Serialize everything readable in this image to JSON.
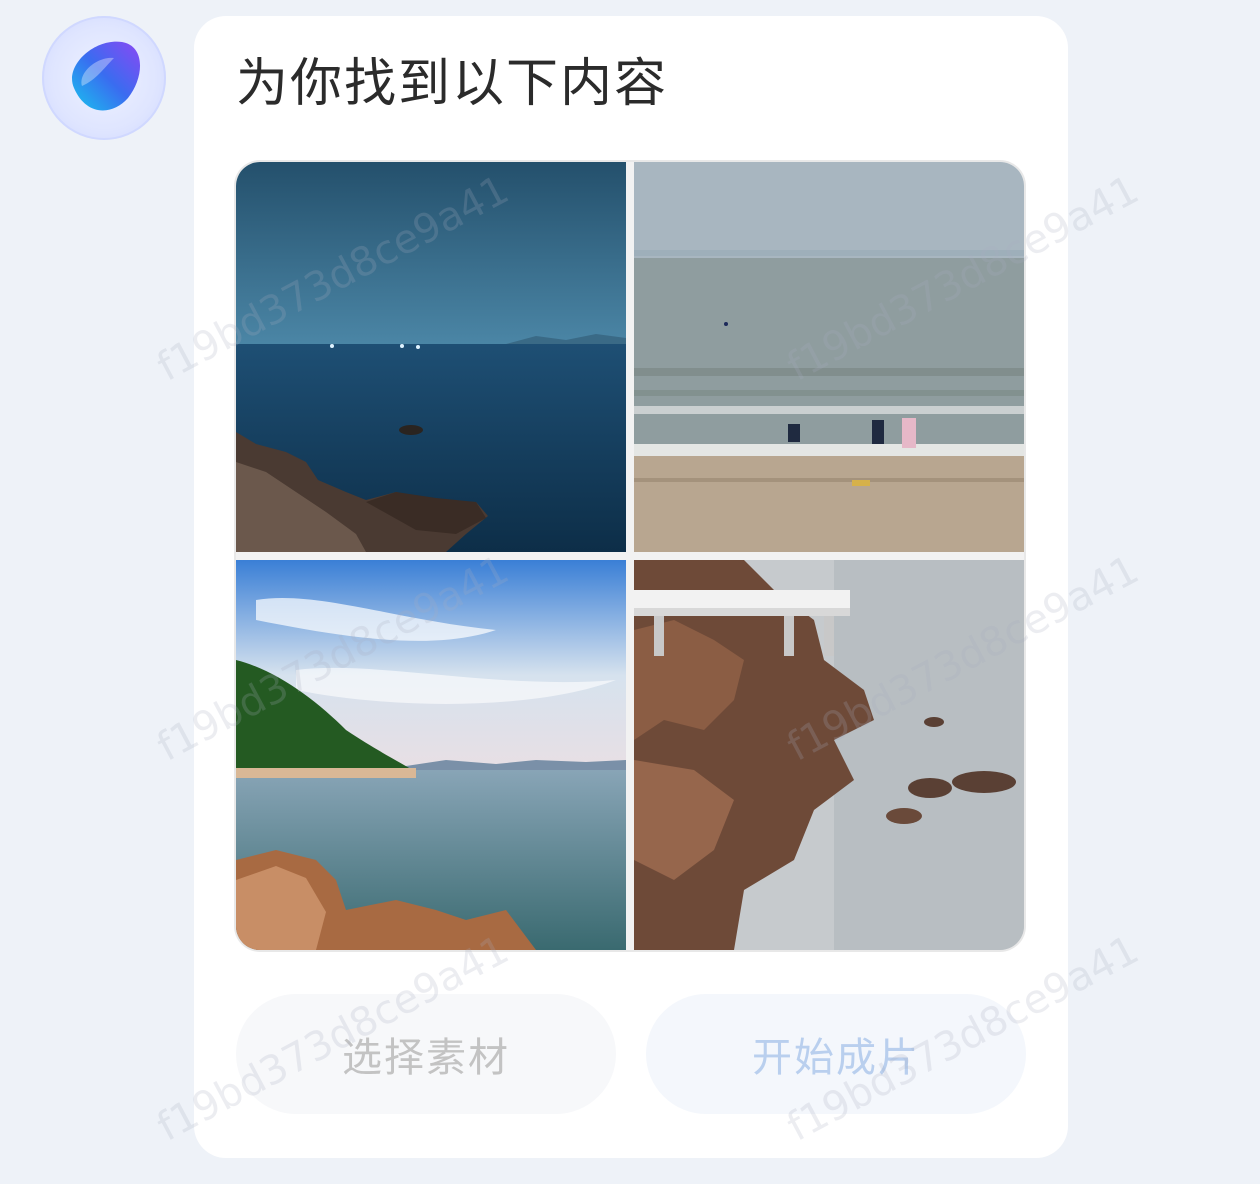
{
  "card": {
    "title": "为你找到以下内容"
  },
  "results": {
    "images": [
      {
        "name": "dusk-sea-with-rocks"
      },
      {
        "name": "beach-with-people"
      },
      {
        "name": "coast-with-green-hill"
      },
      {
        "name": "rocky-shore-with-boardwalk"
      }
    ]
  },
  "actions": {
    "select_label": "选择素材",
    "start_label": "开始成片"
  },
  "watermark": {
    "text": "f19bd373d8ce9a41"
  },
  "colors": {
    "background": "#eef2f8",
    "card": "#ffffff",
    "title_text": "#2b2b2b",
    "select_text": "#c3c3c3",
    "start_text": "#b9cfee"
  }
}
